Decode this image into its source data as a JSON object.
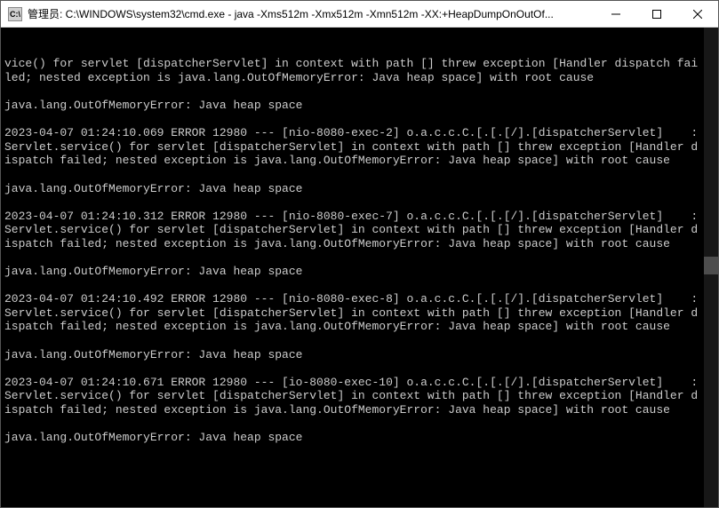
{
  "title_bar": {
    "icon_label": "C:\\",
    "title": "管理员: C:\\WINDOWS\\system32\\cmd.exe - java  -Xms512m -Xmx512m -Xmn512m -XX:+HeapDumpOnOutOf..."
  },
  "console": {
    "lines": [
      "vice() for servlet [dispatcherServlet] in context with path [] threw exception [Handler dispatch failed; nested exception is java.lang.OutOfMemoryError: Java heap space] with root cause",
      "",
      "java.lang.OutOfMemoryError: Java heap space",
      "",
      "2023-04-07 01:24:10.069 ERROR 12980 --- [nio-8080-exec-2] o.a.c.c.C.[.[.[/].[dispatcherServlet]    : Servlet.service() for servlet [dispatcherServlet] in context with path [] threw exception [Handler dispatch failed; nested exception is java.lang.OutOfMemoryError: Java heap space] with root cause",
      "",
      "java.lang.OutOfMemoryError: Java heap space",
      "",
      "2023-04-07 01:24:10.312 ERROR 12980 --- [nio-8080-exec-7] o.a.c.c.C.[.[.[/].[dispatcherServlet]    : Servlet.service() for servlet [dispatcherServlet] in context with path [] threw exception [Handler dispatch failed; nested exception is java.lang.OutOfMemoryError: Java heap space] with root cause",
      "",
      "java.lang.OutOfMemoryError: Java heap space",
      "",
      "2023-04-07 01:24:10.492 ERROR 12980 --- [nio-8080-exec-8] o.a.c.c.C.[.[.[/].[dispatcherServlet]    : Servlet.service() for servlet [dispatcherServlet] in context with path [] threw exception [Handler dispatch failed; nested exception is java.lang.OutOfMemoryError: Java heap space] with root cause",
      "",
      "java.lang.OutOfMemoryError: Java heap space",
      "",
      "2023-04-07 01:24:10.671 ERROR 12980 --- [io-8080-exec-10] o.a.c.c.C.[.[.[/].[dispatcherServlet]    : Servlet.service() for servlet [dispatcherServlet] in context with path [] threw exception [Handler dispatch failed; nested exception is java.lang.OutOfMemoryError: Java heap space] with root cause",
      "",
      "java.lang.OutOfMemoryError: Java heap space",
      ""
    ]
  }
}
